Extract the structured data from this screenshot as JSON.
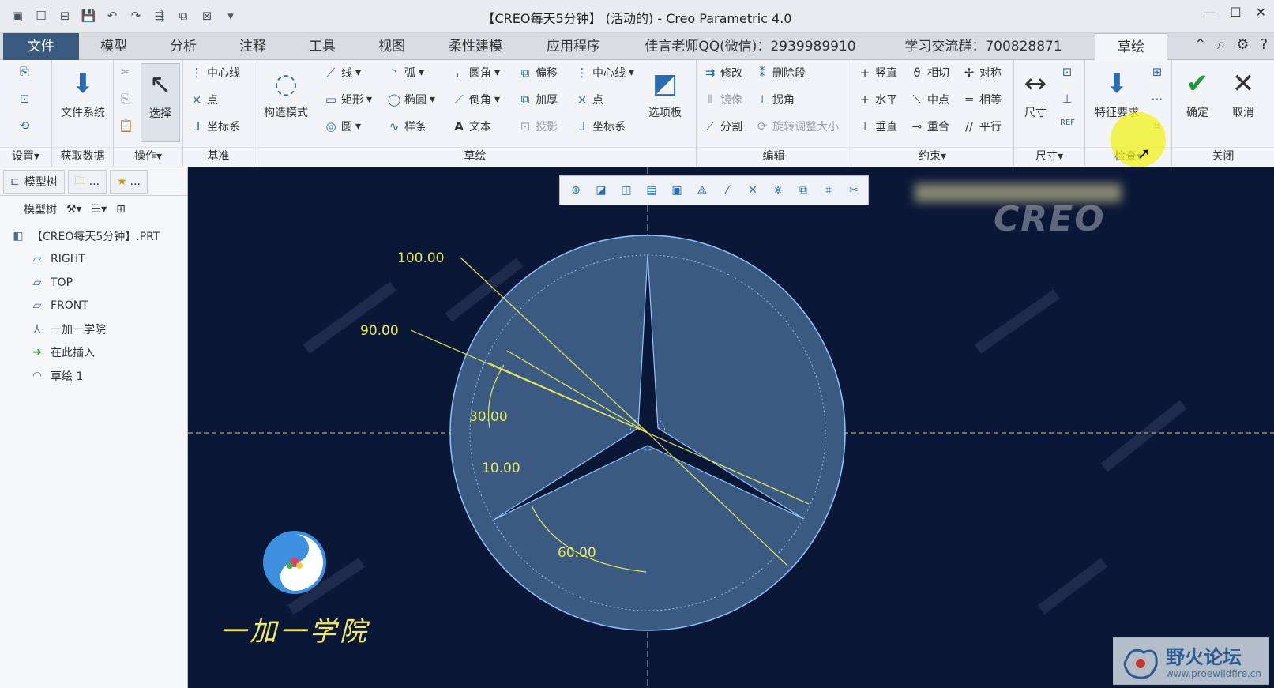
{
  "window": {
    "title": "【CREO每天5分钟】 (活动的) - Creo Parametric 4.0"
  },
  "tabs": [
    "文件",
    "模型",
    "分析",
    "注释",
    "工具",
    "视图",
    "柔性建模",
    "应用程序",
    "佳言老师QQ(微信)：2939989910",
    "学习交流群：700828871",
    "草绘"
  ],
  "ribbon": {
    "groups": {
      "setup": "设置▾",
      "getdata": "获取数据",
      "operations": "操作▾",
      "datum": "基准",
      "sketch": "草绘",
      "edit": "编辑",
      "constrain": "约束▾",
      "dimension": "尺寸▾",
      "inspect": "检查▾",
      "close": "关闭"
    },
    "filesystem": "文件系统",
    "select": "选择",
    "datum_items": [
      "中心线",
      "点",
      "坐标系"
    ],
    "construction": "构造模式",
    "sketch_col1": [
      "线",
      "矩形",
      "圆"
    ],
    "sketch_col2": [
      "弧",
      "椭圆",
      "样条"
    ],
    "sketch_col3": [
      "圆角",
      "倒角",
      "文本"
    ],
    "sketch_col4": [
      "偏移",
      "加厚",
      "投影"
    ],
    "sketch_col5": [
      "中心线",
      "点",
      "坐标系"
    ],
    "palette": "选项板",
    "edit_col1": [
      "修改",
      "镜像",
      "分割"
    ],
    "edit_col2": [
      "删除段",
      "拐角",
      "旋转调整大小"
    ],
    "constrain_col1": [
      "竖直",
      "水平",
      "垂直"
    ],
    "constrain_col2": [
      "相切",
      "中点",
      "重合"
    ],
    "constrain_col3": [
      "对称",
      "相等",
      "平行"
    ],
    "dimension": "尺寸",
    "feature_req": "特征要求",
    "ok": "确定",
    "cancel": "取消"
  },
  "panel": {
    "tab_model_tree": "模型树",
    "tab2": "...",
    "tab3": "...",
    "tree_label": "模型树",
    "items": [
      "【CREO每天5分钟】.PRT",
      "RIGHT",
      "TOP",
      "FRONT",
      "一加一学院",
      "在此插入",
      "草绘 1"
    ]
  },
  "dimensions": [
    "100.00",
    "90.00",
    "30.00",
    "10.00",
    "60.00"
  ],
  "logo_text": "一加一学院",
  "forum": {
    "name": "野火论坛",
    "url": "www.proewildfire.cn"
  },
  "colors": {
    "canvas": "#0b1736",
    "sketch_fill": "#3b5a82",
    "sketch_line": "#8fc4ff",
    "dim_line": "#e8e85a",
    "highlight": "#f2f21a"
  }
}
